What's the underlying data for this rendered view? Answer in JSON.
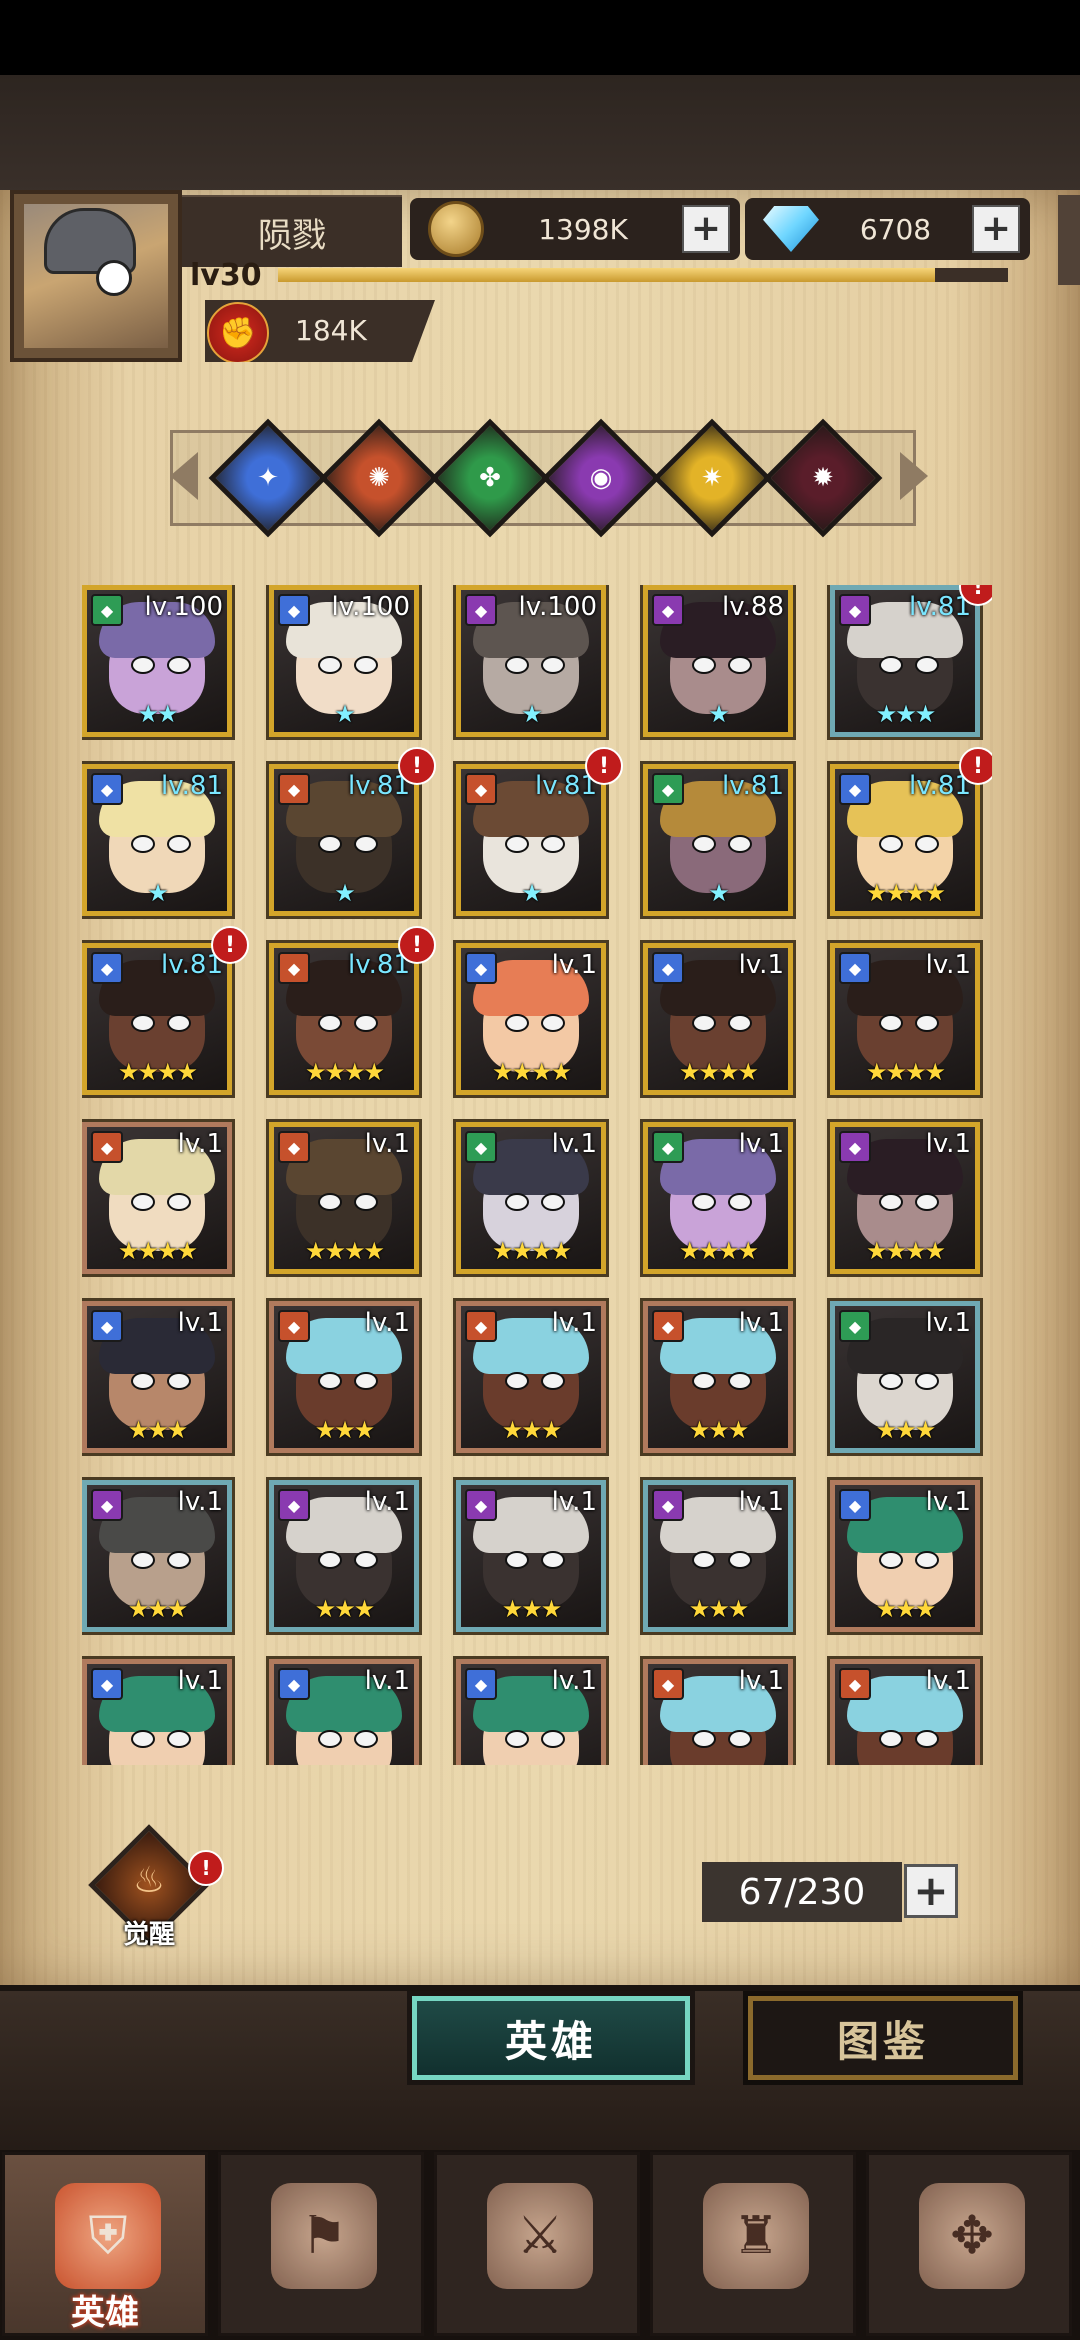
{
  "player": {
    "name": "陨戮",
    "level_label": "lv30",
    "xp_fraction": 0.9,
    "power": "184K"
  },
  "currencies": {
    "gold": "1398K",
    "diamonds": "6708"
  },
  "factions": [
    {
      "name": "faction-light-icon",
      "color": "#3f6fd8",
      "glyph": "✦"
    },
    {
      "name": "faction-fire-icon",
      "color": "#c6512c",
      "glyph": "✺"
    },
    {
      "name": "faction-nature-icon",
      "color": "#2f9a4a",
      "glyph": "✤"
    },
    {
      "name": "faction-arcane-icon",
      "color": "#8a3ab0",
      "glyph": "◉"
    },
    {
      "name": "faction-holy-icon",
      "color": "#e3b327",
      "glyph": "✷"
    },
    {
      "name": "faction-dark-icon",
      "color": "#5a1d2a",
      "glyph": "✹"
    }
  ],
  "heroes": [
    {
      "lv": "lv.100",
      "stars": "★★",
      "star_color": "cyan",
      "quality": "q4",
      "faction": "#2e9c55",
      "alert": false,
      "skin": "#c9a3d8",
      "hair": "#7a6aa8"
    },
    {
      "lv": "lv.100",
      "stars": "★",
      "star_color": "cyan",
      "quality": "q4",
      "faction": "#3f6fd8",
      "alert": false,
      "skin": "#f1ddc8",
      "hair": "#e8e3d8"
    },
    {
      "lv": "lv.100",
      "stars": "★",
      "star_color": "cyan",
      "quality": "q4",
      "faction": "#8a3ab0",
      "alert": false,
      "skin": "#b6aaa3",
      "hair": "#5d5550"
    },
    {
      "lv": "lv.88",
      "stars": "★",
      "star_color": "cyan",
      "quality": "q4",
      "faction": "#8a3ab0",
      "alert": false,
      "skin": "#a98c8c",
      "hair": "#2a1d24"
    },
    {
      "lv": "lv.81",
      "stars": "★★★",
      "star_color": "cyan",
      "quality": "q3",
      "faction": "#8a3ab0",
      "alert": true,
      "skin": "#3a3230",
      "hair": "#d6d2cc"
    },
    {
      "lv": "lv.81",
      "stars": "★",
      "star_color": "cyan",
      "quality": "q4",
      "faction": "#3f6fd8",
      "alert": false,
      "skin": "#f0d8b8",
      "hair": "#efe1a4"
    },
    {
      "lv": "lv.81",
      "stars": "★",
      "star_color": "cyan",
      "quality": "q4",
      "faction": "#c6512c",
      "alert": true,
      "skin": "#3c3128",
      "hair": "#5a4631"
    },
    {
      "lv": "lv.81",
      "stars": "★",
      "star_color": "cyan",
      "quality": "q4",
      "faction": "#c6512c",
      "alert": true,
      "skin": "#e9e4dc",
      "hair": "#6b4a34"
    },
    {
      "lv": "lv.81",
      "stars": "★",
      "star_color": "cyan",
      "quality": "q4",
      "faction": "#2e9c55",
      "alert": false,
      "skin": "#8a6a7a",
      "hair": "#b58a3a"
    },
    {
      "lv": "lv.81",
      "stars": "★★★★",
      "star_color": "gold",
      "quality": "q4",
      "faction": "#3f6fd8",
      "alert": true,
      "skin": "#f3d3a8",
      "hair": "#e6c257"
    },
    {
      "lv": "lv.81",
      "stars": "★★★★",
      "star_color": "gold",
      "quality": "q4",
      "faction": "#3f6fd8",
      "alert": true,
      "skin": "#6a4030",
      "hair": "#2a1e1a"
    },
    {
      "lv": "lv.81",
      "stars": "★★★★",
      "star_color": "gold",
      "quality": "q4",
      "faction": "#c6512c",
      "alert": true,
      "skin": "#7a4a36",
      "hair": "#2a1e1a"
    },
    {
      "lv": "lv.1",
      "stars": "★★★★",
      "star_color": "gold",
      "quality": "q4",
      "faction": "#3f6fd8",
      "alert": false,
      "skin": "#f3c9a5",
      "hair": "#e77d55"
    },
    {
      "lv": "lv.1",
      "stars": "★★★★",
      "star_color": "gold",
      "quality": "q4",
      "faction": "#3f6fd8",
      "alert": false,
      "skin": "#6a4030",
      "hair": "#2a1e1a"
    },
    {
      "lv": "lv.1",
      "stars": "★★★★",
      "star_color": "gold",
      "quality": "q4",
      "faction": "#3f6fd8",
      "alert": false,
      "skin": "#6a4030",
      "hair": "#2a1e1a"
    },
    {
      "lv": "lv.1",
      "stars": "★★★★",
      "star_color": "gold",
      "quality": "q2",
      "faction": "#c6512c",
      "alert": false,
      "skin": "#f0dcc0",
      "hair": "#e3d8a8"
    },
    {
      "lv": "lv.1",
      "stars": "★★★★",
      "star_color": "gold",
      "quality": "q4",
      "faction": "#c6512c",
      "alert": false,
      "skin": "#3c3128",
      "hair": "#5a4631"
    },
    {
      "lv": "lv.1",
      "stars": "★★★★",
      "star_color": "gold",
      "quality": "q4",
      "faction": "#2e9c55",
      "alert": false,
      "skin": "#d7d2dc",
      "hair": "#3a3a4a"
    },
    {
      "lv": "lv.1",
      "stars": "★★★★",
      "star_color": "gold",
      "quality": "q4",
      "faction": "#2e9c55",
      "alert": false,
      "skin": "#c9a3d8",
      "hair": "#7a6aa8"
    },
    {
      "lv": "lv.1",
      "stars": "★★★★",
      "star_color": "gold",
      "quality": "q4",
      "faction": "#8a3ab0",
      "alert": false,
      "skin": "#a98c8c",
      "hair": "#2a1d24"
    },
    {
      "lv": "lv.1",
      "stars": "★★★",
      "star_color": "gold",
      "quality": "q2",
      "faction": "#3f6fd8",
      "alert": false,
      "skin": "#b7876a",
      "hair": "#2a2a36"
    },
    {
      "lv": "lv.1",
      "stars": "★★★",
      "star_color": "gold",
      "quality": "q2",
      "faction": "#c6512c",
      "alert": false,
      "skin": "#6a3c2c",
      "hair": "#8ad2e0"
    },
    {
      "lv": "lv.1",
      "stars": "★★★",
      "star_color": "gold",
      "quality": "q2",
      "faction": "#c6512c",
      "alert": false,
      "skin": "#6a3c2c",
      "hair": "#8ad2e0"
    },
    {
      "lv": "lv.1",
      "stars": "★★★",
      "star_color": "gold",
      "quality": "q2",
      "faction": "#c6512c",
      "alert": false,
      "skin": "#6a3c2c",
      "hair": "#8ad2e0"
    },
    {
      "lv": "lv.1",
      "stars": "★★★",
      "star_color": "gold",
      "quality": "q3",
      "faction": "#2e9c55",
      "alert": false,
      "skin": "#dcd6cf",
      "hair": "#2a2626"
    },
    {
      "lv": "lv.1",
      "stars": "★★★",
      "star_color": "gold",
      "quality": "q3",
      "faction": "#8a3ab0",
      "alert": false,
      "skin": "#b8a08c",
      "hair": "#4a4a48"
    },
    {
      "lv": "lv.1",
      "stars": "★★★",
      "star_color": "gold",
      "quality": "q3",
      "faction": "#8a3ab0",
      "alert": false,
      "skin": "#3a3230",
      "hair": "#d6d2cc"
    },
    {
      "lv": "lv.1",
      "stars": "★★★",
      "star_color": "gold",
      "quality": "q3",
      "faction": "#8a3ab0",
      "alert": false,
      "skin": "#3a3230",
      "hair": "#d6d2cc"
    },
    {
      "lv": "lv.1",
      "stars": "★★★",
      "star_color": "gold",
      "quality": "q3",
      "faction": "#8a3ab0",
      "alert": false,
      "skin": "#3a3230",
      "hair": "#d6d2cc"
    },
    {
      "lv": "lv.1",
      "stars": "★★★",
      "star_color": "gold",
      "quality": "q2",
      "faction": "#3f6fd8",
      "alert": false,
      "skin": "#f0cfb0",
      "hair": "#2f8e6f"
    },
    {
      "lv": "lv.1",
      "stars": "",
      "star_color": "gold",
      "quality": "q2",
      "faction": "#3f6fd8",
      "alert": false,
      "skin": "#f0cfb0",
      "hair": "#2f8e6f"
    },
    {
      "lv": "lv.1",
      "stars": "",
      "star_color": "gold",
      "quality": "q2",
      "faction": "#3f6fd8",
      "alert": false,
      "skin": "#f0cfb0",
      "hair": "#2f8e6f"
    },
    {
      "lv": "lv.1",
      "stars": "",
      "star_color": "gold",
      "quality": "q2",
      "faction": "#3f6fd8",
      "alert": false,
      "skin": "#f0cfb0",
      "hair": "#2f8e6f"
    },
    {
      "lv": "lv.1",
      "stars": "",
      "star_color": "gold",
      "quality": "q2",
      "faction": "#c6512c",
      "alert": false,
      "skin": "#6a3c2c",
      "hair": "#8ad2e0"
    },
    {
      "lv": "lv.1",
      "stars": "",
      "star_color": "gold",
      "quality": "q2",
      "faction": "#c6512c",
      "alert": false,
      "skin": "#6a3c2c",
      "hair": "#8ad2e0"
    }
  ],
  "alert_mark": "!",
  "awaken": {
    "label": "觉醒",
    "glyph": "♨"
  },
  "roster_count": "67/230",
  "plus_glyph": "+",
  "sub_tabs": {
    "heroes": "英雄",
    "codex": "图鉴"
  },
  "nav": [
    {
      "name": "nav-heroes",
      "label": "英雄",
      "active": true,
      "glyph": "⛨"
    },
    {
      "name": "nav-adventure",
      "label": "",
      "active": false,
      "glyph": "⚑"
    },
    {
      "name": "nav-battle",
      "label": "",
      "active": false,
      "glyph": "⚔"
    },
    {
      "name": "nav-castle",
      "label": "",
      "active": false,
      "glyph": "♜"
    },
    {
      "name": "nav-guild",
      "label": "",
      "active": false,
      "glyph": "✥"
    }
  ]
}
